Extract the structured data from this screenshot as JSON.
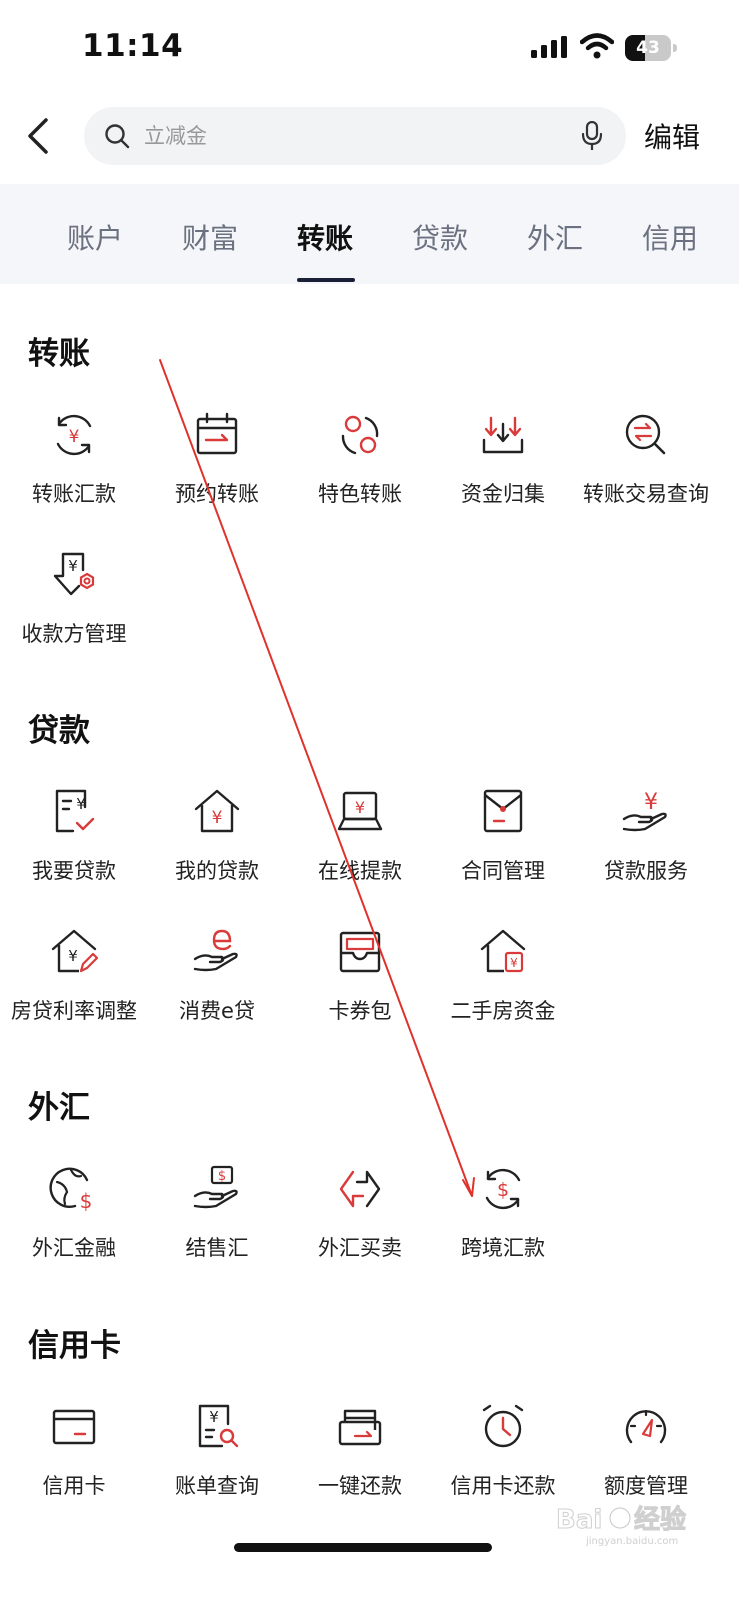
{
  "status_bar": {
    "time": "11:14",
    "battery": "43",
    "battery_level": 0.43
  },
  "search": {
    "placeholder": "立减金"
  },
  "header": {
    "edit_label": "编辑"
  },
  "tabs": [
    {
      "label": "账户",
      "active": false
    },
    {
      "label": "财富",
      "active": false
    },
    {
      "label": "转账",
      "active": true
    },
    {
      "label": "贷款",
      "active": false
    },
    {
      "label": "外汇",
      "active": false
    },
    {
      "label": "信用",
      "active": false
    }
  ],
  "sections": [
    {
      "title": "转账",
      "items": [
        {
          "label": "转账汇款",
          "icon": "yuan-cycle-icon"
        },
        {
          "label": "预约转账",
          "icon": "calendar-transfer-icon"
        },
        {
          "label": "特色转账",
          "icon": "circles-icon"
        },
        {
          "label": "资金归集",
          "icon": "collect-funds-icon"
        },
        {
          "label": "转账交易查询",
          "icon": "transfer-search-icon"
        },
        {
          "label": "收款方管理",
          "icon": "payee-settings-icon"
        }
      ]
    },
    {
      "title": "贷款",
      "items": [
        {
          "label": "我要贷款",
          "icon": "loan-apply-icon"
        },
        {
          "label": "我的贷款",
          "icon": "house-yuan-icon"
        },
        {
          "label": "在线提款",
          "icon": "laptop-yuan-icon"
        },
        {
          "label": "合同管理",
          "icon": "contract-envelope-icon"
        },
        {
          "label": "贷款服务",
          "icon": "hand-yuan-icon"
        },
        {
          "label": "房贷利率调整",
          "icon": "house-edit-icon"
        },
        {
          "label": "消费e贷",
          "icon": "hand-e-icon"
        },
        {
          "label": "卡券包",
          "icon": "coupon-wallet-icon"
        },
        {
          "label": "二手房资金",
          "icon": "house-fund-icon"
        }
      ]
    },
    {
      "title": "外汇",
      "items": [
        {
          "label": "外汇金融",
          "icon": "globe-dollar-icon"
        },
        {
          "label": "结售汇",
          "icon": "hand-dollar-icon"
        },
        {
          "label": "外汇买卖",
          "icon": "exchange-arrows-icon"
        },
        {
          "label": "跨境汇款",
          "icon": "dollar-cycle-icon"
        }
      ]
    },
    {
      "title": "信用卡",
      "items": [
        {
          "label": "信用卡",
          "icon": "credit-card-icon"
        },
        {
          "label": "账单查询",
          "icon": "bill-search-icon"
        },
        {
          "label": "一键还款",
          "icon": "card-repay-icon"
        },
        {
          "label": "信用卡还款",
          "icon": "alarm-clock-icon"
        },
        {
          "label": "额度管理",
          "icon": "gauge-icon"
        }
      ]
    }
  ],
  "colors": {
    "accent": "#d93a3a",
    "dark": "#222222",
    "annotation_arrow": "#e0322c"
  }
}
